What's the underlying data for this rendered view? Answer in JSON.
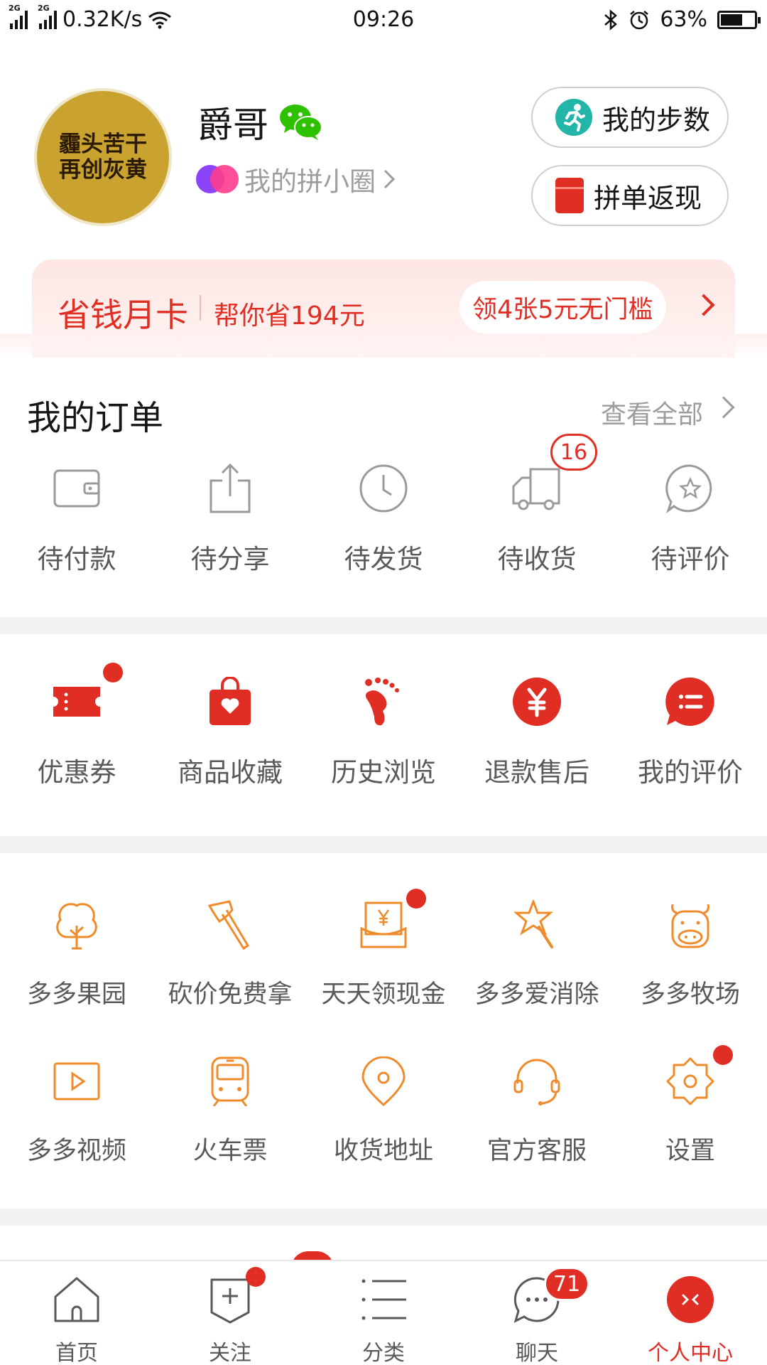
{
  "status_bar": {
    "net1": "2G",
    "net2": "2G",
    "speed": "0.32K/s",
    "time": "09:26",
    "battery": "63%",
    "battery_level": 0.63
  },
  "profile": {
    "avatar_text": "霾头苦干 再创灰黄",
    "nickname": "爵哥",
    "circle_link": "我的拼小圈",
    "steps_button": "我的步数",
    "cashback_button": "拼单返现"
  },
  "banner": {
    "title": "省钱月卡",
    "saved": "帮你省194元",
    "coupon": "领4张5元无门槛"
  },
  "orders": {
    "title": "我的订单",
    "view_all": "查看全部",
    "items": [
      {
        "label": "待付款",
        "icon": "wallet-icon"
      },
      {
        "label": "待分享",
        "icon": "share-icon"
      },
      {
        "label": "待发货",
        "icon": "clock-icon"
      },
      {
        "label": "待收货",
        "icon": "truck-icon",
        "badge": "16"
      },
      {
        "label": "待评价",
        "icon": "review-icon"
      }
    ]
  },
  "tools": {
    "items": [
      {
        "label": "优惠券",
        "icon": "coupon-icon"
      },
      {
        "label": "商品收藏",
        "icon": "favorite-bag-icon"
      },
      {
        "label": "历史浏览",
        "icon": "footprint-icon"
      },
      {
        "label": "退款售后",
        "icon": "refund-icon"
      },
      {
        "label": "我的评价",
        "icon": "comment-icon"
      }
    ]
  },
  "games": {
    "row1": [
      {
        "label": "多多果园",
        "icon": "tree-icon"
      },
      {
        "label": "砍价免费拿",
        "icon": "axe-icon"
      },
      {
        "label": "天天领现金",
        "icon": "cash-envelope-icon"
      },
      {
        "label": "多多爱消除",
        "icon": "star-wand-icon"
      },
      {
        "label": "多多牧场",
        "icon": "cow-icon"
      }
    ],
    "row2": [
      {
        "label": "多多视频",
        "icon": "video-icon"
      },
      {
        "label": "火车票",
        "icon": "train-icon"
      },
      {
        "label": "收货地址",
        "icon": "location-icon"
      },
      {
        "label": "官方客服",
        "icon": "headset-icon"
      },
      {
        "label": "设置",
        "icon": "settings-icon"
      }
    ]
  },
  "tabbar": {
    "items": [
      {
        "label": "首页",
        "icon": "home-icon"
      },
      {
        "label": "关注",
        "icon": "follow-icon"
      },
      {
        "label": "分类",
        "icon": "category-icon"
      },
      {
        "label": "聊天",
        "icon": "chat-icon",
        "badge": "71"
      },
      {
        "label": "个人中心",
        "icon": "profile-icon"
      }
    ]
  },
  "colors": {
    "brand_red": "#e02e24",
    "accent_orange": "#f08b2c",
    "text_gray": "#58595b"
  }
}
